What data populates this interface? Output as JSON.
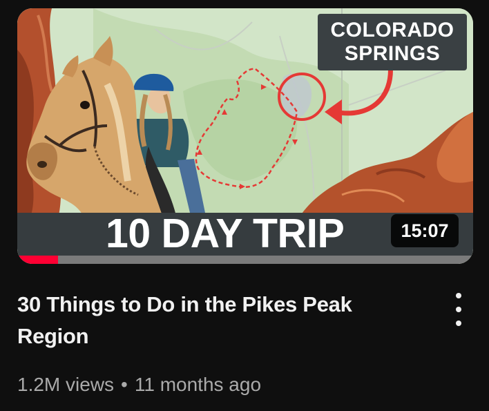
{
  "video": {
    "thumbnail": {
      "callout_line1": "COLORADO",
      "callout_line2": "SPRINGS",
      "banner": "10 DAY TRIP",
      "duration": "15:07",
      "watch_progress": 0.09,
      "progress_color": "#ff0033"
    },
    "title": "30 Things to Do in the Pikes Peak Region",
    "views": "1.2M views",
    "separator": "•",
    "age": "11 months ago",
    "more_icon": "more-vert-icon"
  }
}
